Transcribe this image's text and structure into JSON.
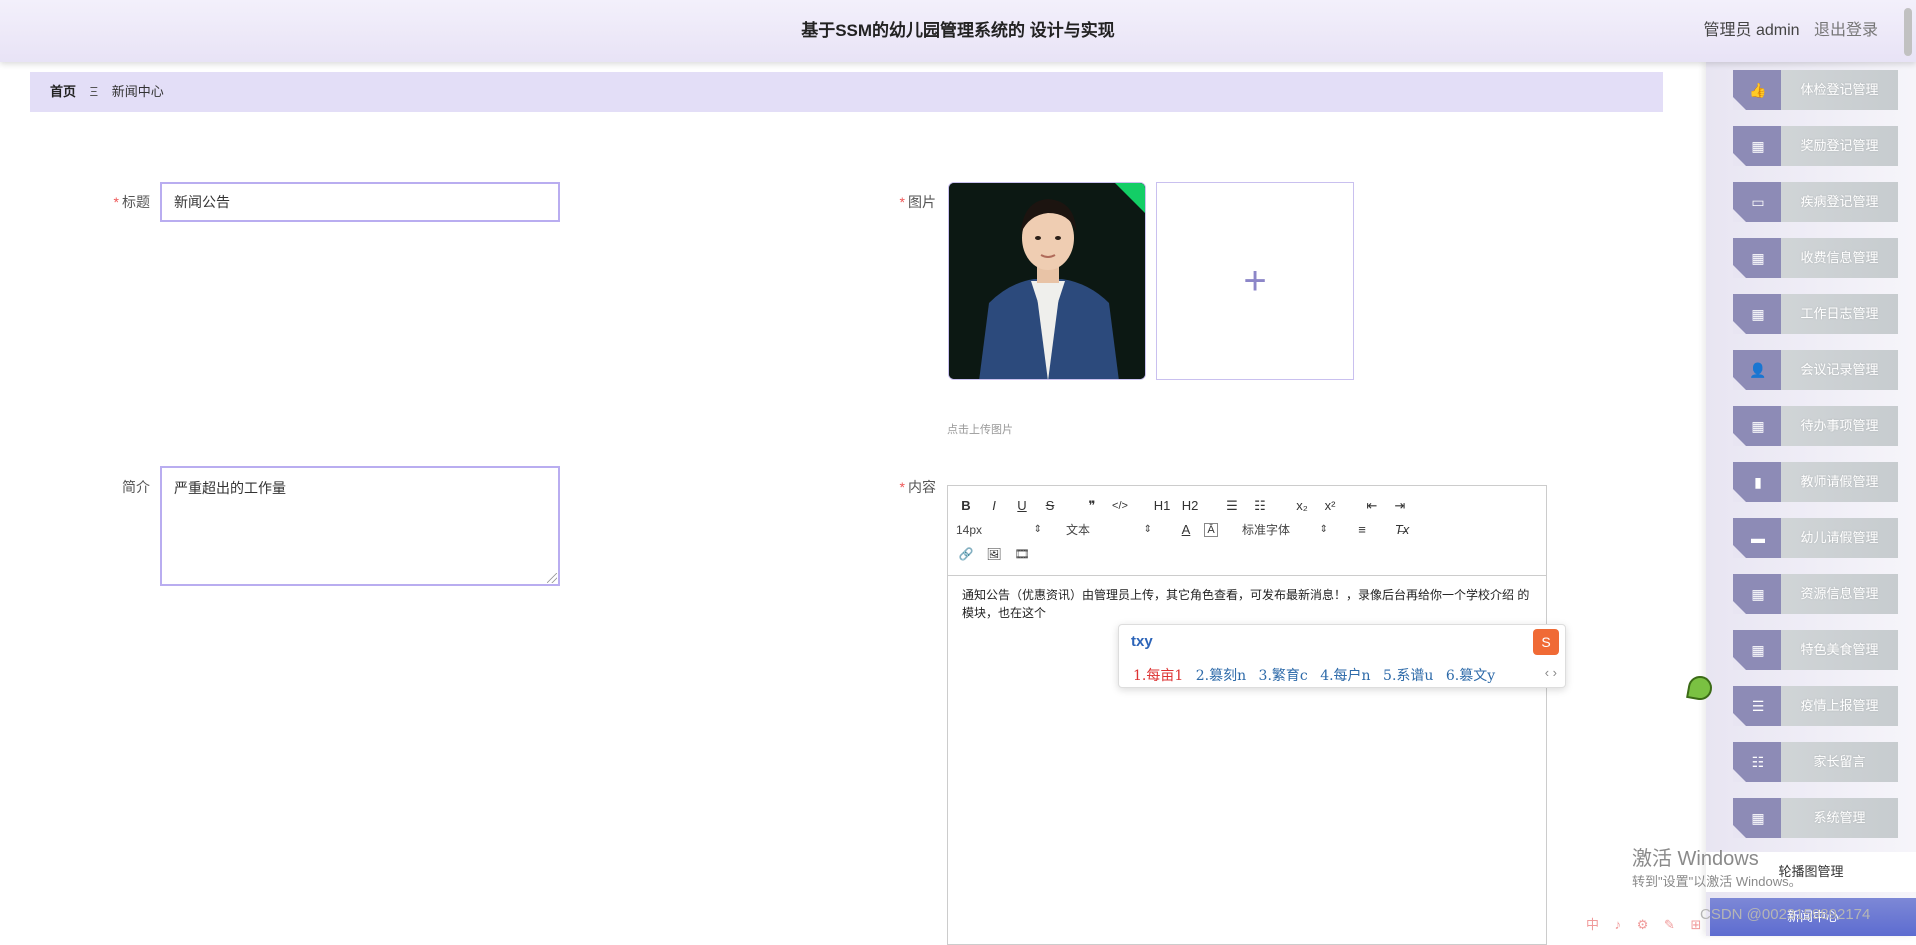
{
  "header": {
    "title": "基于SSM的幼儿园管理系统的 设计与实现",
    "user_label": "管理员 admin",
    "logout_label": "退出登录"
  },
  "breadcrumb": {
    "home": "首页",
    "separator": "Ξ",
    "current": "新闻中心"
  },
  "form": {
    "title_label": "标题",
    "title_value": "新闻公告",
    "intro_label": "简介",
    "intro_value": "严重超出的工作量",
    "image_label": "图片",
    "image_tip": "点击上传图片",
    "content_label": "内容",
    "required_mark": "*"
  },
  "editor": {
    "font_size": "14px",
    "block_type": "文本",
    "font_family": "标准字体",
    "content": "通知公告（优惠资讯）由管理员上传，其它角色查看，可发布最新消息！，录像后台再给你一个学校介绍 的模块，也在这个",
    "toolbar_row1": [
      "B",
      "I",
      "U",
      "S",
      "❞",
      "</>",
      "H1",
      "H2",
      "☰",
      "☷",
      "x₂",
      "x²",
      "⇤",
      "⇥"
    ],
    "toolbar_row2_icons": [
      "A",
      "Ā",
      "≡",
      "T̶x"
    ],
    "toolbar_row3": [
      "🔗",
      "🖼",
      "🎞"
    ]
  },
  "ime": {
    "composition": "txy",
    "candidates": [
      "1.每亩1",
      "2.篡刻n",
      "3.繁育c",
      "4.每户n",
      "5.系谱u",
      "6.篡文y"
    ],
    "nav": "‹ ›"
  },
  "sidebar": {
    "items": [
      {
        "label": "体检登记管理",
        "icon": "thumb-icon"
      },
      {
        "label": "奖励登记管理",
        "icon": "grid-icon"
      },
      {
        "label": "疾病登记管理",
        "icon": "monitor-icon"
      },
      {
        "label": "收费信息管理",
        "icon": "grid-icon"
      },
      {
        "label": "工作日志管理",
        "icon": "grid-icon"
      },
      {
        "label": "会议记录管理",
        "icon": "user-icon"
      },
      {
        "label": "待办事项管理",
        "icon": "grid-icon"
      },
      {
        "label": "教师请假管理",
        "icon": "chart-icon"
      },
      {
        "label": "幼儿请假管理",
        "icon": "briefcase-icon"
      },
      {
        "label": "资源信息管理",
        "icon": "grid-icon"
      },
      {
        "label": "特色美食管理",
        "icon": "grid-icon"
      },
      {
        "label": "疫情上报管理",
        "icon": "list-icon"
      },
      {
        "label": "家长留言",
        "icon": "sliders-icon"
      },
      {
        "label": "系统管理",
        "icon": "grid-icon"
      }
    ],
    "carousel_label": "轮播图管理",
    "bottom_label": "新闻中心"
  },
  "overlays": {
    "windows_title": "激活 Windows",
    "windows_sub": "转到\"设置\"以激活 Windows。",
    "csdn": "CSDN @0023159892174",
    "taskbar": "中 ♪ ⚙ ✎ ⊞"
  }
}
